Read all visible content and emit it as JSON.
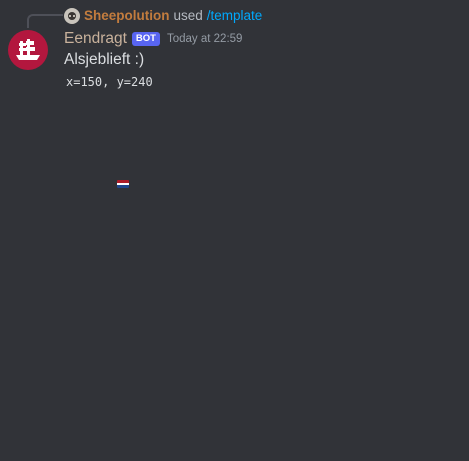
{
  "reply": {
    "user": "Sheepolution",
    "verb": "used",
    "command": "/template",
    "avatar_icon": "sheep-avatar-icon"
  },
  "message": {
    "author": "Eendragt",
    "badge": "BOT",
    "timestamp": "Today at 22:59",
    "text": "Alsjeblieft :)",
    "code": "x=150, y=240",
    "avatar_icon": "ship-avatar-icon",
    "avatar_color": "#b3173e"
  },
  "attachment": {
    "icon": "netherlands-flag-icon",
    "colors": [
      "#ae1c28",
      "#ffffff",
      "#21468b"
    ]
  },
  "theme": {
    "background": "#313338",
    "username_color": "#c9b29c",
    "reply_user_color": "#c27c3e",
    "command_color": "#00a8fc",
    "badge_color": "#5865f2"
  }
}
